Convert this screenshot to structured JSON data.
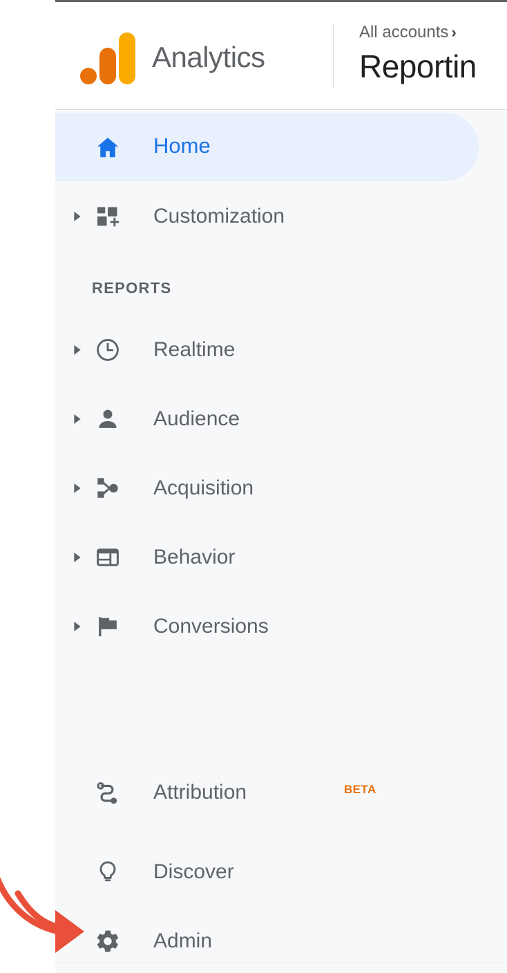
{
  "header": {
    "brand": "Analytics",
    "logo_icon": "google-analytics-logo",
    "breadcrumb": "All accounts",
    "breadcrumb_chevron": "›",
    "page_title": "Reportin"
  },
  "sidebar": {
    "selected_item": "Home",
    "section_label": "REPORTS",
    "items": [
      {
        "label": "Home",
        "icon": "home-icon",
        "expandable": false,
        "selected": true
      },
      {
        "label": "Customization",
        "icon": "customization-icon",
        "expandable": true,
        "selected": false
      }
    ],
    "report_items": [
      {
        "label": "Realtime",
        "icon": "clock-icon",
        "expandable": true
      },
      {
        "label": "Audience",
        "icon": "person-icon",
        "expandable": true
      },
      {
        "label": "Acquisition",
        "icon": "share-node-icon",
        "expandable": true
      },
      {
        "label": "Behavior",
        "icon": "layout-icon",
        "expandable": true
      },
      {
        "label": "Conversions",
        "icon": "flag-icon",
        "expandable": true
      }
    ],
    "footer_items": [
      {
        "label": "Attribution",
        "icon": "attribution-path-icon",
        "badge": "BETA"
      },
      {
        "label": "Discover",
        "icon": "lightbulb-icon",
        "badge": ""
      },
      {
        "label": "Admin",
        "icon": "gear-icon",
        "badge": ""
      }
    ]
  },
  "annotation": {
    "type": "arrow",
    "points_to": "Admin",
    "color": "#e8503a"
  },
  "colors": {
    "accent_blue": "#1a73e8",
    "selected_pill": "#e8f0fe",
    "icon_gray": "#5f6368",
    "sidebar_bg": "#f7f8fa",
    "beta_orange": "#e8710a",
    "logo_orange": "#e8710a",
    "logo_amber": "#f9ab00",
    "annotation_red": "#e8503a"
  }
}
